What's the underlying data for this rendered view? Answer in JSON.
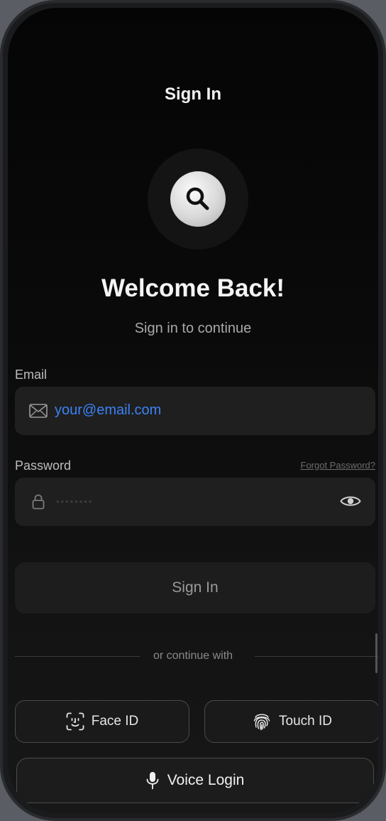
{
  "header": {
    "title": "Sign In"
  },
  "logo": {
    "icon": "search-icon"
  },
  "welcome": {
    "heading": "Welcome Back!",
    "subtitle": "Sign in to continue"
  },
  "email": {
    "label": "Email",
    "value": "your@email.com",
    "icon": "mail-icon"
  },
  "password": {
    "label": "Password",
    "forgot_label": "Forgot Password?",
    "masked_value": "••••••••",
    "icon": "lock-icon",
    "toggle_icon": "eye-icon"
  },
  "primary": {
    "sign_in_label": "Sign In"
  },
  "divider": {
    "text": "or continue with"
  },
  "alternatives": {
    "face_id_label": "Face ID",
    "touch_id_label": "Touch ID",
    "voice_label": "Voice Login"
  },
  "colors": {
    "accent": "#3b82f6",
    "background": "#0a0a0a"
  }
}
